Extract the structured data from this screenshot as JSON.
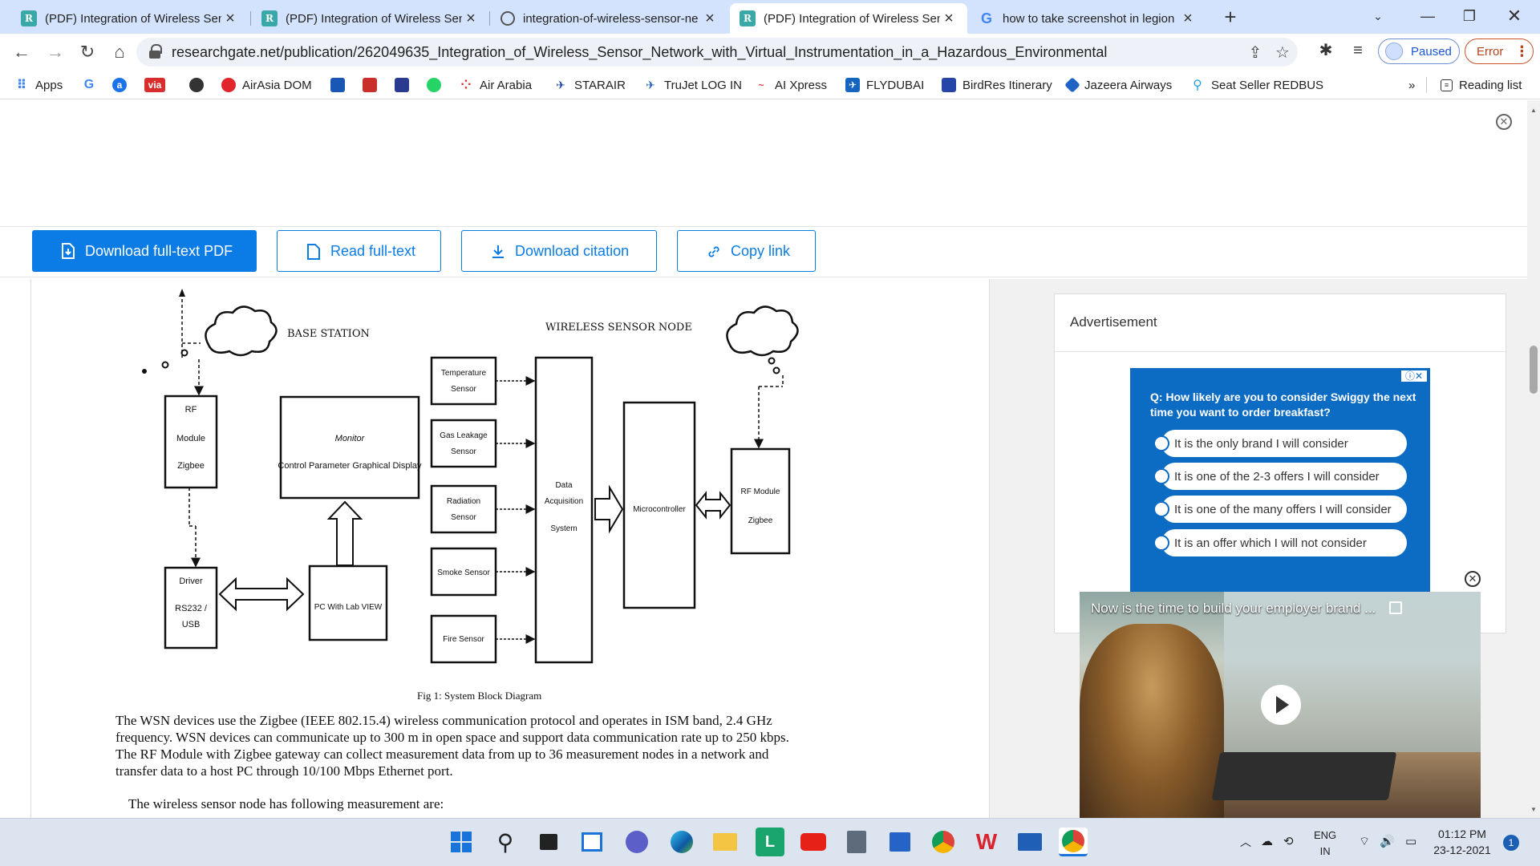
{
  "tabs": [
    {
      "title": "(PDF) Integration of Wireless Sen",
      "icon": "researchgate-icon",
      "active": false
    },
    {
      "title": "(PDF) Integration of Wireless Sen",
      "icon": "researchgate-icon",
      "active": false
    },
    {
      "title": "integration-of-wireless-sensor-ne",
      "icon": "globe-icon",
      "active": false
    },
    {
      "title": "(PDF) Integration of Wireless Sen",
      "icon": "researchgate-icon",
      "active": true
    },
    {
      "title": "how to take screenshot in legion",
      "icon": "google-icon",
      "active": false
    }
  ],
  "address_bar": {
    "url": "researchgate.net/publication/262049635_Integration_of_Wireless_Sensor_Network_with_Virtual_Instrumentation_in_a_Hazardous_Environmental"
  },
  "profile": {
    "paused_label": "Paused",
    "error_label": "Error"
  },
  "bookmarks": [
    {
      "label": "Apps",
      "color": "#4285f4"
    },
    {
      "label": "",
      "color": "#4285f4"
    },
    {
      "label": "",
      "color": "#1a73e8"
    },
    {
      "label": "via",
      "color": "#d92d2d"
    },
    {
      "label": "",
      "color": "#c22"
    },
    {
      "label": "AirAsia DOM",
      "color": "#e0252c"
    },
    {
      "label": "",
      "color": "#1a57b5"
    },
    {
      "label": "",
      "color": "#c9302c"
    },
    {
      "label": "",
      "color": "#2a3b8f"
    },
    {
      "label": "",
      "color": "#25d366"
    },
    {
      "label": "Air Arabia",
      "color": "#d32f2f"
    },
    {
      "label": "STARAIR",
      "color": "#1a46a8"
    },
    {
      "label": "TruJet LOG IN",
      "color": "#1e5fb8"
    },
    {
      "label": "AI Xpress",
      "color": "#e53935"
    },
    {
      "label": "FLYDUBAI",
      "color": "#1565c0"
    },
    {
      "label": "BirdRes Itinerary",
      "color": "#2545a8"
    },
    {
      "label": "Jazeera Airways",
      "color": "#1e63c5"
    },
    {
      "label": "Seat Seller REDBUS",
      "color": "#2aa3e0"
    }
  ],
  "bookmarks_more": "»",
  "reading_list": "Reading list",
  "actions": {
    "download_pdf": "Download full-text PDF",
    "read_fulltext": "Read full-text",
    "download_citation": "Download citation",
    "copy_link": "Copy link"
  },
  "diagram": {
    "base_station": "BASE STATION",
    "wireless_node": "WIRELESS SENSOR NODE",
    "rf_module_left": [
      "RF",
      "Module",
      "Zigbee"
    ],
    "monitor": [
      "Monitor",
      "Control Parameter Graphical Display"
    ],
    "driver": [
      "Driver",
      "RS232 /",
      "USB"
    ],
    "pc": "PC With Lab VIEW",
    "sensors": [
      [
        "Temperature",
        "Sensor"
      ],
      [
        "Gas Leakage",
        "Sensor"
      ],
      [
        "Radiation",
        "Sensor"
      ],
      [
        "Smoke Sensor"
      ],
      [
        "Fire Sensor"
      ]
    ],
    "daq": [
      "Data",
      "Acquisition",
      "System"
    ],
    "microcontroller": "Microcontroller",
    "rf_module_right": [
      "RF Module",
      "Zigbee"
    ]
  },
  "caption": "Fig 1: System Block Diagram",
  "paragraph": "The WSN devices use the Zigbee (IEEE 802.15.4) wireless communication protocol and operates in ISM band, 2.4 GHz frequency. WSN devices can communicate up to 300 m in open space and support data communication rate up to 250 kbps. The RF Module with Zigbee  gateway can collect measurement data from up to 36 measurement nodes in a network and transfer data to a host PC through 10/100 Mbps Ethernet port.",
  "paragraph2": "The wireless sensor node has following measurement are:",
  "ad": {
    "label": "Advertisement",
    "question": "Q: How likely are you to consider Swiggy the next time you want to order breakfast?",
    "options": [
      "It is the only brand I will consider",
      "It is one of the 2-3 offers I will consider",
      "It is one of the many offers I will consider",
      "It is an offer which I will not consider"
    ],
    "video_title": "Now is the time to build your employer brand ..."
  },
  "taskbar": {
    "lang": "ENG",
    "region": "IN",
    "time": "01:12 PM",
    "date": "23-12-2021",
    "notifications": "1"
  }
}
